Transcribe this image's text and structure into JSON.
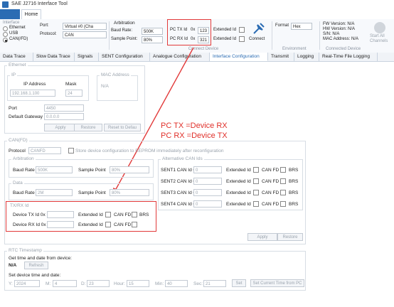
{
  "window": {
    "title": "SAE J2716 Interface Tool"
  },
  "ribbon_tabs": {
    "home": "Home"
  },
  "interface": {
    "label": "Interface",
    "options": [
      "Ethernet",
      "USB",
      "CAN(/FD)"
    ],
    "selected_index": 2,
    "port_label": "Port:",
    "port_value": "Virtual #0 (Cha",
    "protocol_label": "Protocol:",
    "protocol_value": "CAN"
  },
  "arbitration": {
    "label": "Arbitration",
    "baud_rate_label": "Baud Rate:",
    "baud_rate_value": "500K",
    "sample_point_label": "Sample Point:",
    "sample_point_value": "80%"
  },
  "ids": {
    "pc_tx_label": "PC TX Id",
    "pc_tx_prefix": "0x",
    "pc_tx_value": "123",
    "pc_rx_label": "PC RX Id",
    "pc_rx_prefix": "0x",
    "pc_rx_value": "321",
    "extended_label": "Extended Id"
  },
  "connect": {
    "label": "Connect",
    "group_label": "Connect Device"
  },
  "environment": {
    "format_label": "Format",
    "format_value": "Hex",
    "group_label": "Environment"
  },
  "device_info": {
    "fw": "FW Version: N/A",
    "hw": "HW Version: N/A",
    "sn": "S/N: N/A",
    "mac": "MAC Address: N/A",
    "group_label": "Connected Device"
  },
  "start_all": {
    "label1": "Start All",
    "label2": "Channels"
  },
  "tabs": [
    "Data Trace",
    "Slow Data Trace",
    "Signals",
    "SENT Configuration",
    "Analogue Configuration",
    "Interface Configuration",
    "Transmit",
    "Logging",
    "Real-Time File Logging"
  ],
  "active_tab_index": 5,
  "ethernet": {
    "title": "Ethernet",
    "ip_group": "IP",
    "ip_address_label": "IP Address",
    "mask_label": "Mask",
    "ip_value": "192.168.1.100",
    "mask_value": "24",
    "mac_group": "MAC Address",
    "mac_value": "N/A",
    "port_label": "Port",
    "port_value": "4450",
    "gateway_label": "Default Gateway",
    "gateway_value": "0.0.0.0",
    "apply": "Apply",
    "restore": "Restore",
    "reset": "Reset to Defau"
  },
  "canfd": {
    "title": "CAN(FD)",
    "protocol_label": "Protocol",
    "protocol_value": "CANFD",
    "store_label": "Store device configuration to EEPROM immediately after reconfiguration",
    "arbitration_group": "Arbitration",
    "baud_rate_label": "Baud Rate",
    "baud_rate_value": "500K",
    "sample_point_label": "Sample Point",
    "sample_point_value": "80%",
    "data_group": "Data",
    "data_baud_value": "2M",
    "data_sample_value": "80%",
    "txrx_group": "TX/RX Id",
    "device_tx_label": "Device TX Id 0x",
    "device_rx_label": "Device RX Id 0x",
    "extended_label": "Extended Id",
    "can_fd_label": "CAN FD",
    "brs_label": "BRS",
    "alt_group": "Alternative CAN Ids",
    "sent_rows": [
      "SENT1 CAN Id 0x",
      "SENT2 CAN Id 0x",
      "SENT3 CAN Id 0x",
      "SENT4 CAN Id 0x"
    ],
    "sent_value": "0",
    "apply": "Apply",
    "restore": "Restore"
  },
  "annotation": {
    "line1": "PC TX  =Device RX",
    "line2": "PC RX  =Device TX"
  },
  "rtc": {
    "title": "RTC Timestamp",
    "get_label": "Get time and date from device:",
    "get_value": "N/A",
    "refresh": "Refresh",
    "set_label": "Set device time and date:",
    "y_label": "Y:",
    "y_value": "2024",
    "m_label": "M:",
    "m_value": "4",
    "d_label": "D:",
    "d_value": "23",
    "hour_label": "Hour:",
    "hour_value": "15",
    "min_label": "Min:",
    "min_value": "40",
    "sec_label": "Sec:",
    "sec_value": "21",
    "set": "Set",
    "set_from_pc": "Set Current Time from PC"
  },
  "colors": {
    "accent": "#2b6cb3",
    "highlight": "#e23a3a"
  }
}
